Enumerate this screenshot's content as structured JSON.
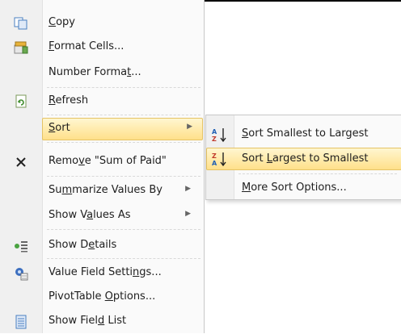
{
  "menu": {
    "copy": {
      "before": "",
      "accel": "C",
      "after": "opy"
    },
    "format_cells": {
      "before": "",
      "accel": "F",
      "after": "ormat Cells..."
    },
    "number_format": {
      "before": "Number Forma",
      "accel": "t",
      "after": "..."
    },
    "refresh": {
      "before": "",
      "accel": "R",
      "after": "efresh"
    },
    "sort": {
      "before": "",
      "accel": "S",
      "after": "ort"
    },
    "remove": {
      "before": "Remo",
      "accel": "v",
      "after": "e \"Sum of Paid\""
    },
    "summarize": {
      "before": "Su",
      "accel": "m",
      "after": "marize Values By"
    },
    "show_values_as": {
      "before": "Show V",
      "accel": "a",
      "after": "lues As"
    },
    "show_details": {
      "before": "Show D",
      "accel": "e",
      "after": "tails"
    },
    "value_field_settings": {
      "before": "Value Field Setti",
      "accel": "n",
      "after": "gs..."
    },
    "pivottable_options": {
      "before": "PivotTable ",
      "accel": "O",
      "after": "ptions..."
    },
    "show_field_list": {
      "before": "Show Fiel",
      "accel": "d",
      "after": " List"
    }
  },
  "submenu": {
    "sort_smallest": {
      "before": "",
      "accel": "S",
      "after": "ort Smallest to Largest"
    },
    "sort_largest": {
      "before": "Sort ",
      "accel": "L",
      "after": "argest to Smallest"
    },
    "more_sort": {
      "before": "",
      "accel": "M",
      "after": "ore Sort Options..."
    }
  },
  "colors": {
    "highlight_top": "#fff6d0",
    "highlight_bottom": "#ffe08a",
    "highlight_border": "#e5c365"
  }
}
